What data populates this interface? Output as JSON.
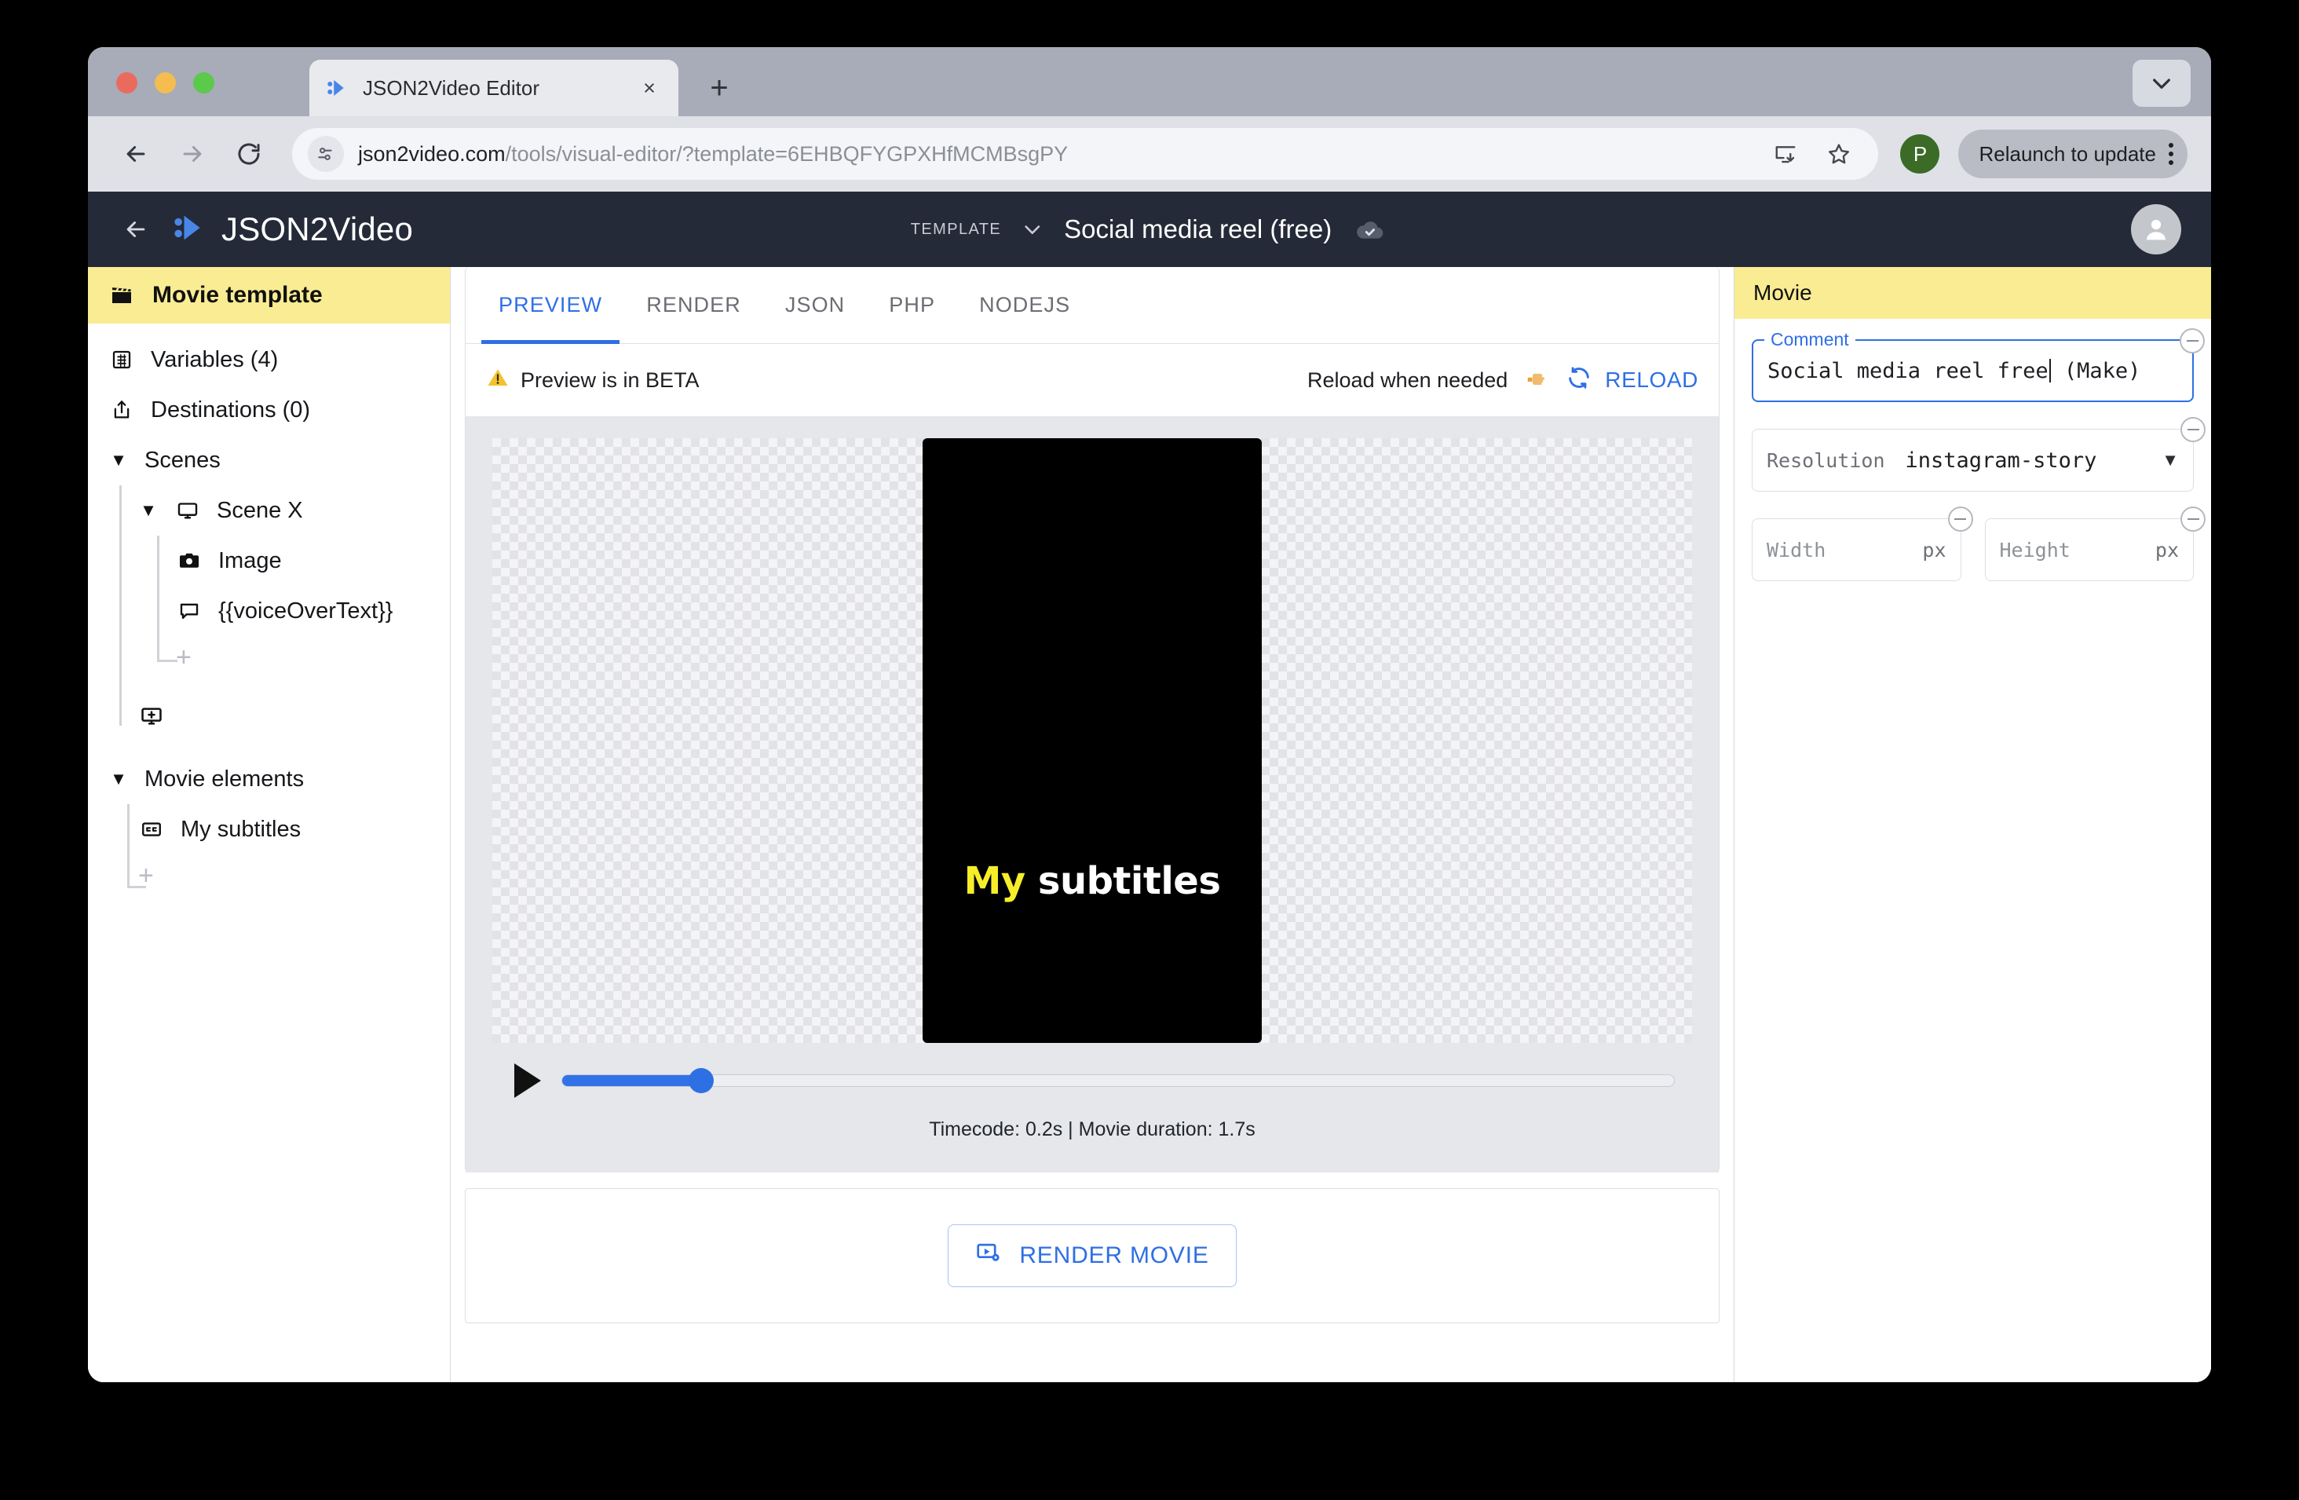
{
  "browser": {
    "tab": {
      "title": "JSON2Video Editor",
      "favicon": "json2video-favicon",
      "close": "×",
      "new_tab": "+"
    },
    "url_host": "json2video.com",
    "url_path": "/tools/visual-editor/?template=6EHBQFYGPXHfMCMBsgPY",
    "relaunch_label": "Relaunch to update",
    "profile_initial": "P"
  },
  "app_header": {
    "brand": "JSON2Video",
    "template_label": "TEMPLATE",
    "template_name": "Social media reel (free)",
    "save_status_icon": "cloud-check-icon"
  },
  "sidebar": {
    "header": "Movie template",
    "items": [
      {
        "label": "Variables (4)",
        "icon": "variables-icon"
      },
      {
        "label": "Destinations (0)",
        "icon": "share-icon"
      }
    ],
    "scenes_label": "Scenes",
    "scene": {
      "label": "Scene X",
      "icon": "monitor-icon"
    },
    "scene_children": [
      {
        "label": "Image",
        "icon": "camera-icon"
      },
      {
        "label": "{{voiceOverText}}",
        "icon": "speech-bubble-icon"
      }
    ],
    "movie_elements_label": "Movie elements",
    "movie_elements": [
      {
        "label": "My subtitles",
        "icon": "closed-caption-icon"
      }
    ],
    "add_symbol": "+"
  },
  "main": {
    "tabs": [
      {
        "label": "PREVIEW",
        "active": true
      },
      {
        "label": "RENDER",
        "active": false
      },
      {
        "label": "JSON",
        "active": false
      },
      {
        "label": "PHP",
        "active": false
      },
      {
        "label": "NODEJS",
        "active": false
      }
    ],
    "beta_notice": "Preview is in BETA",
    "beta_icon": "warning-icon",
    "reload_hint": "Reload when needed",
    "reload_hint_icon": "pointing-hand-icon",
    "reload_label": "RELOAD",
    "subtitle_highlight": "My",
    "subtitle_rest": "subtitles",
    "timecode": "Timecode: 0.2s | Movie duration: 1.7s",
    "progress_percent": 12,
    "render_button": "RENDER MOVIE"
  },
  "properties": {
    "header": "Movie",
    "comment": {
      "label": "Comment",
      "value_before_caret": "Social media reel free",
      "value_after_caret": " (Make)"
    },
    "resolution": {
      "label": "Resolution",
      "value": "instagram-story"
    },
    "width": {
      "placeholder": "Width",
      "value": "",
      "unit": "px"
    },
    "height": {
      "placeholder": "Height",
      "value": "",
      "unit": "px"
    }
  },
  "colors": {
    "accent_blue": "#2f6fe4",
    "header_dark": "#242a38",
    "panel_yellow": "#f9ec93",
    "subtitle_yellow": "#f7ee2a"
  }
}
